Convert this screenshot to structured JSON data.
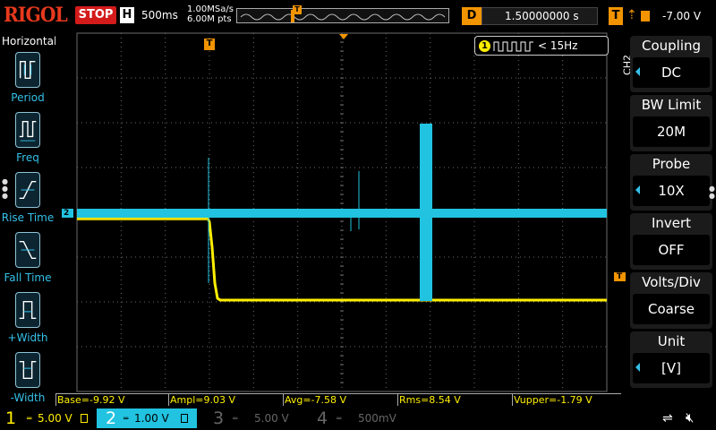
{
  "topbar": {
    "brand": "RIGOL",
    "run_state": "STOP",
    "timebase_label": "H",
    "timebase": "500ms",
    "sample_rate": "1.00MSa/s",
    "memory_depth": "6.00M pts",
    "trigger_pos_marker": "T",
    "delay_label": "D",
    "delay_value": "1.50000000 s",
    "trigger_label": "T",
    "trigger_slope_icon": "rising-edge-icon",
    "trigger_level": "-7.00 V"
  },
  "left_menu": {
    "title": "Horizontal",
    "items": [
      {
        "label": "Period",
        "icon": "period-icon"
      },
      {
        "label": "Freq",
        "icon": "frequency-icon"
      },
      {
        "label": "Rise Time",
        "icon": "rise-time-icon"
      },
      {
        "label": "Fall Time",
        "icon": "fall-time-icon"
      },
      {
        "label": "+Width",
        "icon": "positive-width-icon"
      },
      {
        "label": "-Width",
        "icon": "negative-width-icon"
      }
    ]
  },
  "screen": {
    "ch2_marker": "2",
    "trigger_marker": "T",
    "trigger_level_marker": "T",
    "freq_counter": {
      "channel": "1",
      "value": "< 15Hz"
    }
  },
  "measurements": [
    {
      "label": "Base=-9.92 V"
    },
    {
      "label": "Ampl=9.03 V"
    },
    {
      "label": "Avg=-7.58 V"
    },
    {
      "label": "Rms=8.54 V"
    },
    {
      "label": "Vupper=-1.79 V"
    }
  ],
  "right_menu": {
    "channel_tag": "CH2",
    "items": [
      {
        "title": "Coupling",
        "value": "DC",
        "has_arrow": true
      },
      {
        "title": "BW Limit",
        "value": "20M",
        "has_arrow": false
      },
      {
        "title": "Probe",
        "value": "10X",
        "has_arrow": true
      },
      {
        "title": "Invert",
        "value": "OFF",
        "has_arrow": false
      },
      {
        "title": "Volts/Div",
        "value": "Coarse",
        "has_arrow": false
      },
      {
        "title": "Unit",
        "value": "[V]",
        "has_arrow": true
      }
    ]
  },
  "channels": [
    {
      "num": "1",
      "scale": "5.00 V",
      "color": "#ffef00",
      "active": true
    },
    {
      "num": "2",
      "scale": "1.00 V",
      "color": "#21c3e0",
      "active": true,
      "selected": true
    },
    {
      "num": "3",
      "scale": "5.00 V",
      "color": "#666666",
      "active": false
    },
    {
      "num": "4",
      "scale": "500mV",
      "color": "#666666",
      "active": false
    }
  ],
  "colors": {
    "ch1": "#ffef00",
    "ch2": "#21c3e0",
    "trigger": "#f29400",
    "stop": "#d41b1b",
    "grid": "#6b6b6b"
  }
}
